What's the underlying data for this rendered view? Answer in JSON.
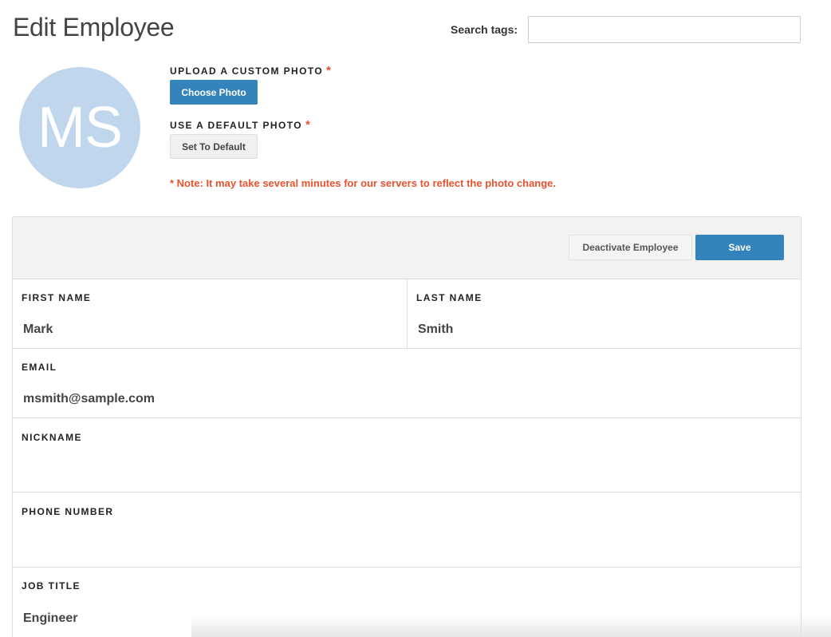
{
  "page": {
    "title": "Edit Employee"
  },
  "search": {
    "label": "Search tags:",
    "value": "",
    "placeholder": ""
  },
  "avatar": {
    "initials": "MS",
    "color": "#bfd6ec"
  },
  "photo": {
    "upload_label": "UPLOAD A CUSTOM PHOTO",
    "choose_button": "Choose Photo",
    "default_label": "USE A DEFAULT PHOTO",
    "default_button": "Set To Default",
    "required_marker": "*",
    "note": "* Note: It may take several minutes for our servers to reflect the photo change."
  },
  "actions": {
    "deactivate_button": "Deactivate Employee",
    "save_button": "Save"
  },
  "fields": {
    "first_name": {
      "label": "FIRST NAME",
      "value": "Mark"
    },
    "last_name": {
      "label": "LAST NAME",
      "value": "Smith"
    },
    "email": {
      "label": "EMAIL",
      "value": "msmith@sample.com"
    },
    "nickname": {
      "label": "NICKNAME",
      "value": ""
    },
    "phone_number": {
      "label": "PHONE NUMBER",
      "value": ""
    },
    "job_title": {
      "label": "JOB TITLE",
      "value": "Engineer"
    }
  },
  "colors": {
    "primary": "#3583bb",
    "required": "#e8532f",
    "avatar": "#bfd6ec"
  }
}
